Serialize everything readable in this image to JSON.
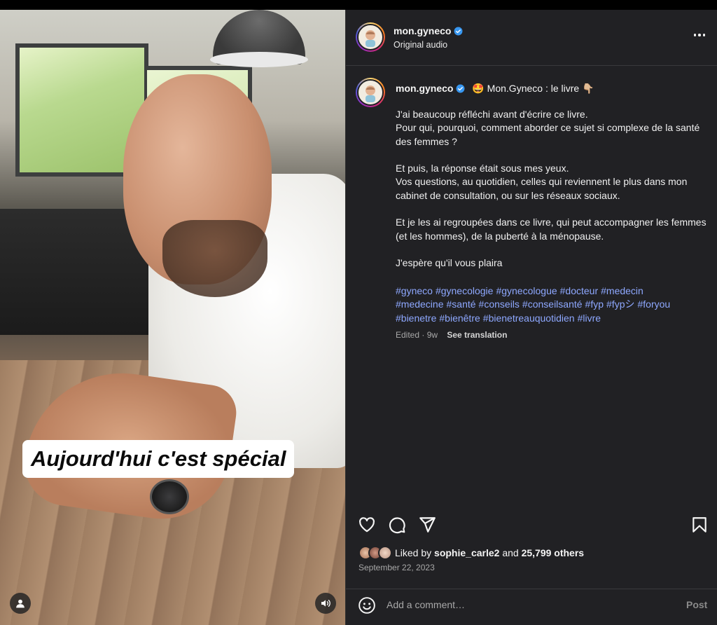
{
  "post": {
    "author": "mon.gyneco",
    "audio": "Original audio",
    "video_caption_overlay": "Aujourd'hui c'est spécial",
    "caption_title": "🤩 Mon.Gyneco : le livre 👇🏼",
    "caption_paragraphs": [
      "J'ai beaucoup réfléchi avant d'écrire ce livre.\nPour qui, pourquoi, comment aborder ce sujet si complexe de la santé des femmes ?",
      "Et puis, la réponse était sous mes yeux.\nVos questions, au quotidien, celles qui reviennent le plus dans mon cabinet de consultation, ou sur les réseaux sociaux.",
      "Et je les ai regroupées dans ce livre, qui peut accompagner les femmes (et les hommes), de la puberté à la ménopause.",
      "J'espère qu'il vous plaira"
    ],
    "hashtags": [
      "#gyneco",
      "#gynecologie",
      "#gynecologue",
      "#docteur",
      "#medecin",
      "#medecine",
      "#santé",
      "#conseils",
      "#conseilsanté",
      "#fyp",
      "#fypシ",
      "#foryou",
      "#bienetre",
      "#bienêtre",
      "#bienetreauquotidien",
      "#livre"
    ],
    "edited_label": "Edited · 9w",
    "see_translation": "See translation",
    "liked_by_prefix": "Liked by",
    "liked_by_user": "sophie_carle2",
    "liked_by_and": "and",
    "liked_by_others": "25,799 others",
    "date": "September 22, 2023"
  },
  "comment": {
    "placeholder": "Add a comment…",
    "post_label": "Post"
  },
  "colors": {
    "panel_bg": "#212124",
    "hashtag": "#8ea8ff",
    "verified": "#3897f0",
    "muted": "#a8a8a8"
  },
  "icons": [
    "more-icon",
    "heart-icon",
    "comment-icon",
    "share-icon",
    "bookmark-icon",
    "emoji-icon",
    "user-tag-icon",
    "volume-icon",
    "verified-icon"
  ]
}
